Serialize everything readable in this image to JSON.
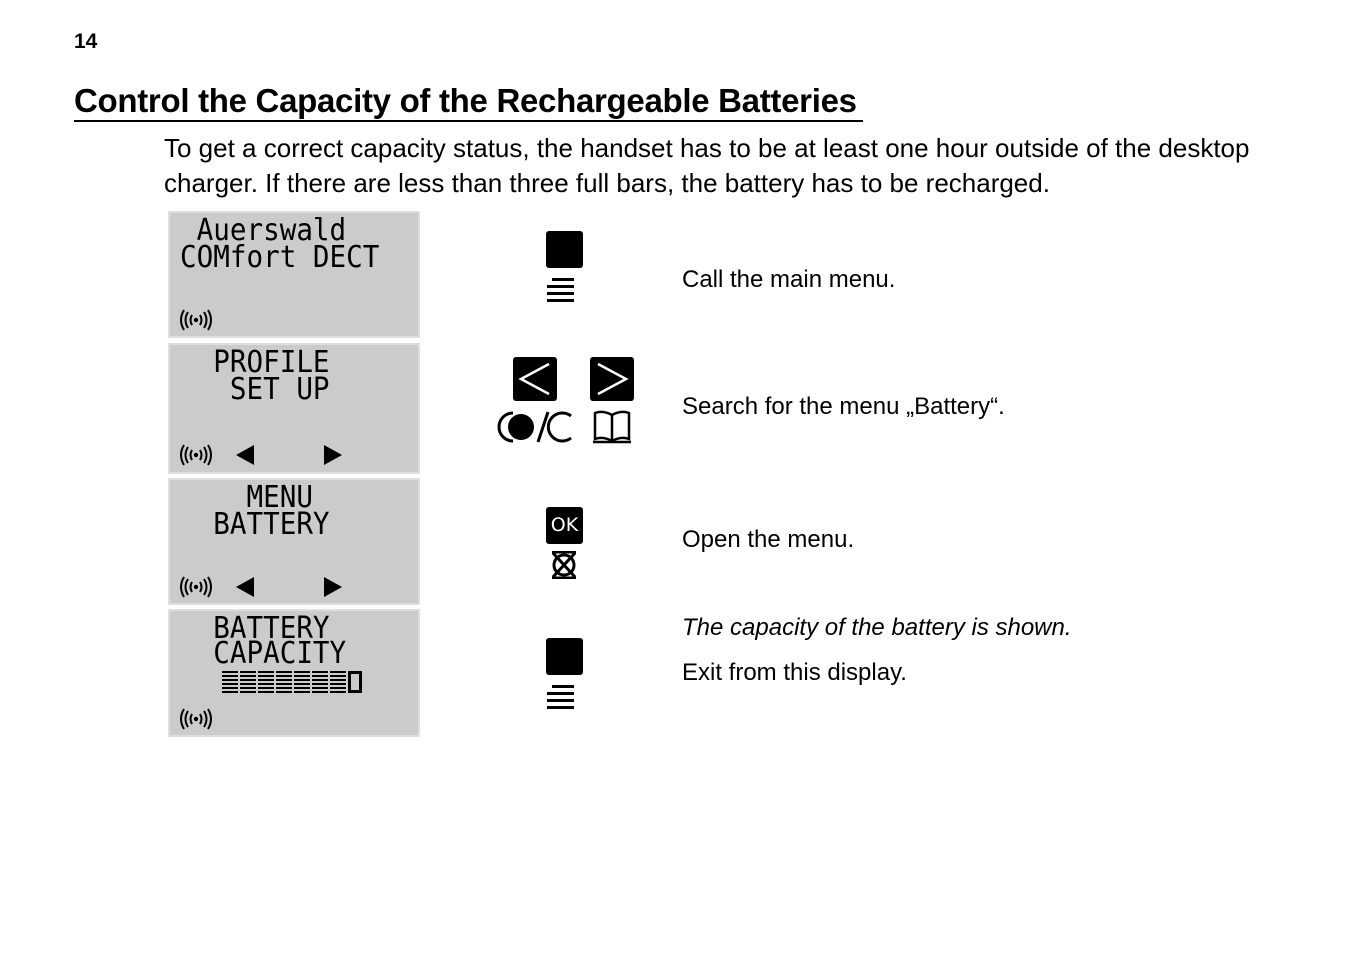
{
  "page_number": "14",
  "heading": "Control the Capacity of the Rechargeable Batteries",
  "intro": "To get a correct capacity status, the handset has to be at least one hour outside of the desktop charger. If there are less than three full bars, the battery has to be recharged.",
  "screens": [
    {
      "lines": [
        " Auerswald",
        "COMfort DECT"
      ],
      "icons": [
        "signal-icon"
      ]
    },
    {
      "lines": [
        "  PROFILE",
        "   SET UP"
      ],
      "icons": [
        "signal-icon",
        "arrow-left-icon",
        "arrow-right-icon"
      ]
    },
    {
      "lines": [
        "    MENU",
        "  BATTERY"
      ],
      "icons": [
        "signal-icon",
        "arrow-left-icon",
        "arrow-right-icon"
      ]
    },
    {
      "lines": [
        "  BATTERY",
        "  CAPACITY"
      ],
      "battery": {
        "full_bars": 7,
        "total_bars": 8
      },
      "icons": [
        "signal-icon"
      ]
    }
  ],
  "steps": [
    {
      "keys": [
        "menu-key",
        "menu-lines-icon"
      ],
      "text": "Call the main menu."
    },
    {
      "keys": [
        "left-key",
        "right-key",
        "mute-clear-icon",
        "phonebook-icon"
      ],
      "text": "Search for the menu „Battery“."
    },
    {
      "keys": [
        "ok-key",
        "ok-symbol-icon"
      ],
      "ok_label": "OK",
      "text": "Open the menu."
    },
    {
      "keys": [
        "menu-key",
        "menu-lines-icon"
      ],
      "note": "The capacity of the battery is shown.",
      "text": "Exit from this display."
    }
  ]
}
